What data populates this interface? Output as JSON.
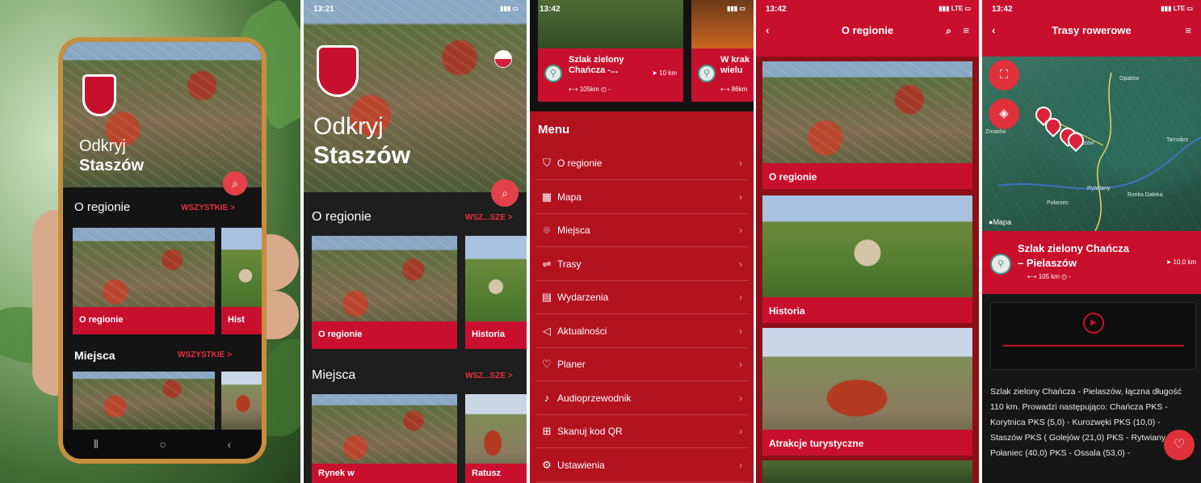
{
  "panel1": {
    "hero_line1": "Odkryj",
    "hero_line2": "Staszów",
    "section1": "O regionie",
    "section1_all": "WSZYSTKIE >",
    "card1": "O regionie",
    "card2": "Hist",
    "section2": "Miejsca",
    "section2_all": "WSZYSTKIE >"
  },
  "panel2": {
    "time": "13:21",
    "hero_line1": "Odkryj",
    "hero_line2": "Staszów",
    "section1": "O regionie",
    "section1_all": "WSZ...SZE >",
    "card1": "O regionie",
    "card2": "Historia",
    "section2": "Miejsca",
    "section2_all": "WSZ...SZE >",
    "card3": "Rynek w",
    "card4": "Ratusz"
  },
  "panel3": {
    "time": "13:42",
    "route_title": "Szlak zielony Chańcza -...",
    "route_distance": "10 km",
    "route_length": "105km",
    "route2_title": "W krak wielu",
    "route2_length": "86km",
    "menu_title": "Menu",
    "menu_items": [
      {
        "label": "O regionie",
        "icon": "shield-icon",
        "glyph": "⛉"
      },
      {
        "label": "Mapa",
        "icon": "map-icon",
        "glyph": "▦"
      },
      {
        "label": "Miejsca",
        "icon": "location-pin-icon",
        "glyph": "⌾"
      },
      {
        "label": "Trasy",
        "icon": "route-icon",
        "glyph": "⇌"
      },
      {
        "label": "Wydarzenia",
        "icon": "calendar-icon",
        "glyph": "▤"
      },
      {
        "label": "Aktualności",
        "icon": "megaphone-icon",
        "glyph": "◁"
      },
      {
        "label": "Planer",
        "icon": "heart-icon",
        "glyph": "♡"
      },
      {
        "label": "Audioprzewodnik",
        "icon": "music-note-icon",
        "glyph": "♪"
      },
      {
        "label": "Skanuj kod QR",
        "icon": "qr-code-icon",
        "glyph": "⊞"
      },
      {
        "label": "Ustawienia",
        "icon": "settings-gear-icon",
        "glyph": "⚙"
      }
    ]
  },
  "panel4": {
    "time": "13:42",
    "title": "O regionie",
    "cards": [
      "O regionie",
      "Historia",
      "Atrakcje turystyczne"
    ]
  },
  "panel5": {
    "time": "13:42",
    "title": "Trasy rowerowe",
    "map_label": "Mapa",
    "towns": [
      "Opatów",
      "Staszów",
      "Zrnatów",
      "Tarnobrz",
      "Rytwiany",
      "Połaniec",
      "Rzeka Daleka"
    ],
    "route_title_line1": "Szlak zielony Chańcza",
    "route_title_line2": "– Pielaszów",
    "route_distance": "10,0 km",
    "route_length": "105 km",
    "description": "Szlak zielony Chańcza - Pielaszów, łączna długość 110 km. Prowadzi następująco: Chańcza PKS - Korytnica PKS (5,0) - Kurozwęki PKS (10,0) - Staszów PKS ( Golejów (21,0) PKS - Rytwiany (24,0) Połaniec (40,0) PKS - Ossala (53,0) -"
  }
}
